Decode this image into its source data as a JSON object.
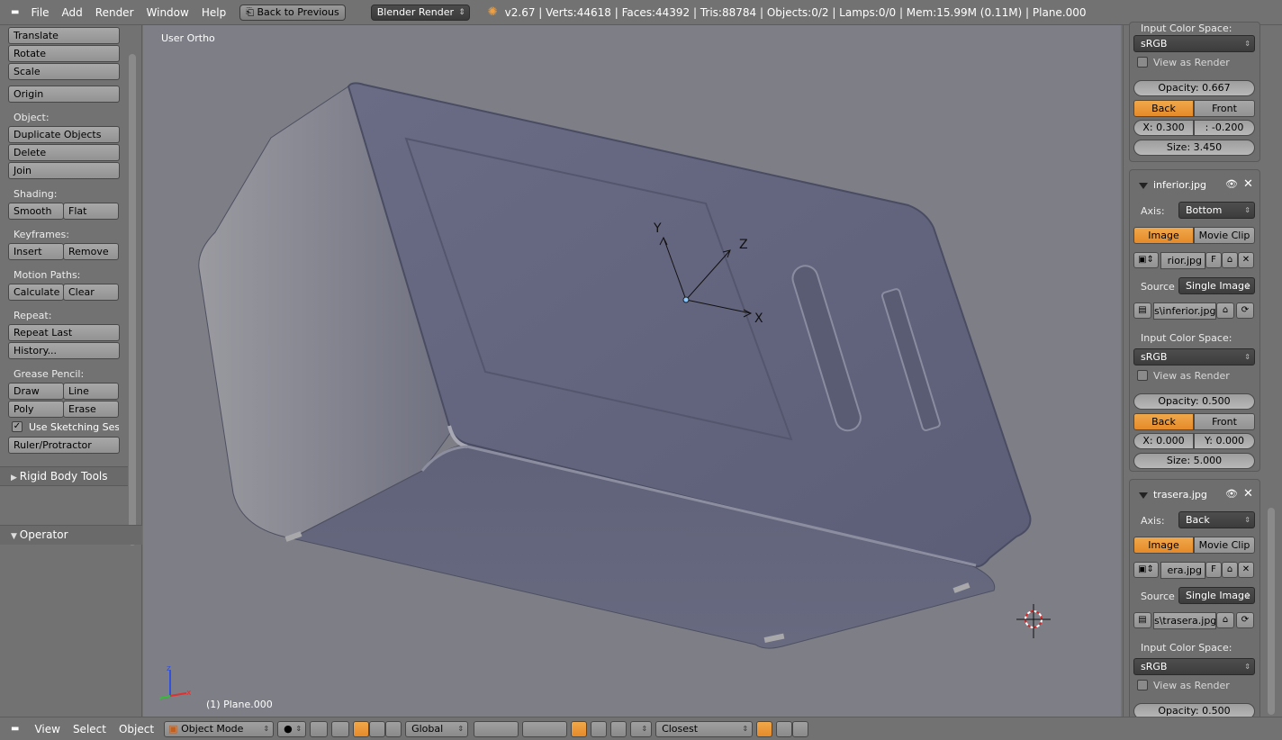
{
  "topbar": {
    "menu": [
      "File",
      "Add",
      "Render",
      "Window",
      "Help"
    ],
    "back_button": "Back to Previous",
    "render_engine": "Blender Render",
    "stats": "v2.67 | Verts:44618 | Faces:44392 | Tris:88784 | Objects:0/2 | Lamps:0/0 | Mem:15.99M (0.11M) | Plane.000"
  },
  "toolshelf": {
    "translate": "Translate",
    "rotate": "Rotate",
    "scale": "Scale",
    "origin": "Origin",
    "object_label": "Object:",
    "duplicate": "Duplicate Objects",
    "delete": "Delete",
    "join": "Join",
    "shading_label": "Shading:",
    "smooth": "Smooth",
    "flat": "Flat",
    "keyframes_label": "Keyframes:",
    "insert": "Insert",
    "remove": "Remove",
    "motion_label": "Motion Paths:",
    "calculate": "Calculate",
    "clear": "Clear",
    "repeat_label": "Repeat:",
    "repeat_last": "Repeat Last",
    "history": "History...",
    "grease_label": "Grease Pencil:",
    "draw": "Draw",
    "line": "Line",
    "poly": "Poly",
    "erase": "Erase",
    "sketching": "Use Sketching Sessi",
    "ruler": "Ruler/Protractor",
    "rigid_body": "Rigid Body Tools",
    "operator": "Operator"
  },
  "viewport": {
    "view_label": "User Ortho",
    "object_label": "(1) Plane.000",
    "axis_labels": [
      "Y",
      "Z",
      "X"
    ]
  },
  "props": {
    "top": {
      "input_color_label": "Input Color Space:",
      "color_space": "sRGB",
      "view_as_render": "View as Render",
      "opacity": "Opacity: 0.667",
      "back": "Back",
      "front": "Front",
      "x": "X: 0.300",
      "y": ": -0.200",
      "size": "Size: 3.450"
    },
    "inferior": {
      "name": "inferior.jpg",
      "axis_label": "Axis:",
      "axis": "Bottom",
      "image": "Image",
      "movie_clip": "Movie Clip",
      "file": "rior.jpg",
      "f": "F",
      "source_label": "Source",
      "source": "Single Image",
      "path": "s\\inferior.jpg",
      "input_color_label": "Input Color Space:",
      "color_space": "sRGB",
      "view_as_render": "View as Render",
      "opacity": "Opacity: 0.500",
      "back": "Back",
      "front": "Front",
      "x": "X: 0.000",
      "y": "Y: 0.000",
      "size": "Size: 5.000"
    },
    "trasera": {
      "name": "trasera.jpg",
      "axis_label": "Axis:",
      "axis": "Back",
      "image": "Image",
      "movie_clip": "Movie Clip",
      "file": "era.jpg",
      "f": "F",
      "source_label": "Source",
      "source": "Single Image",
      "path": "s\\trasera.jpg",
      "input_color_label": "Input Color Space:",
      "color_space": "sRGB",
      "view_as_render": "View as Render",
      "opacity": "Opacity: 0.500"
    }
  },
  "bottombar": {
    "view": "View",
    "select": "Select",
    "object": "Object",
    "mode": "Object Mode",
    "orientation": "Global",
    "snap": "Closest"
  },
  "colors": {
    "accent": "#e58a2a",
    "background": "#727272",
    "viewport": "#7d7e86"
  }
}
